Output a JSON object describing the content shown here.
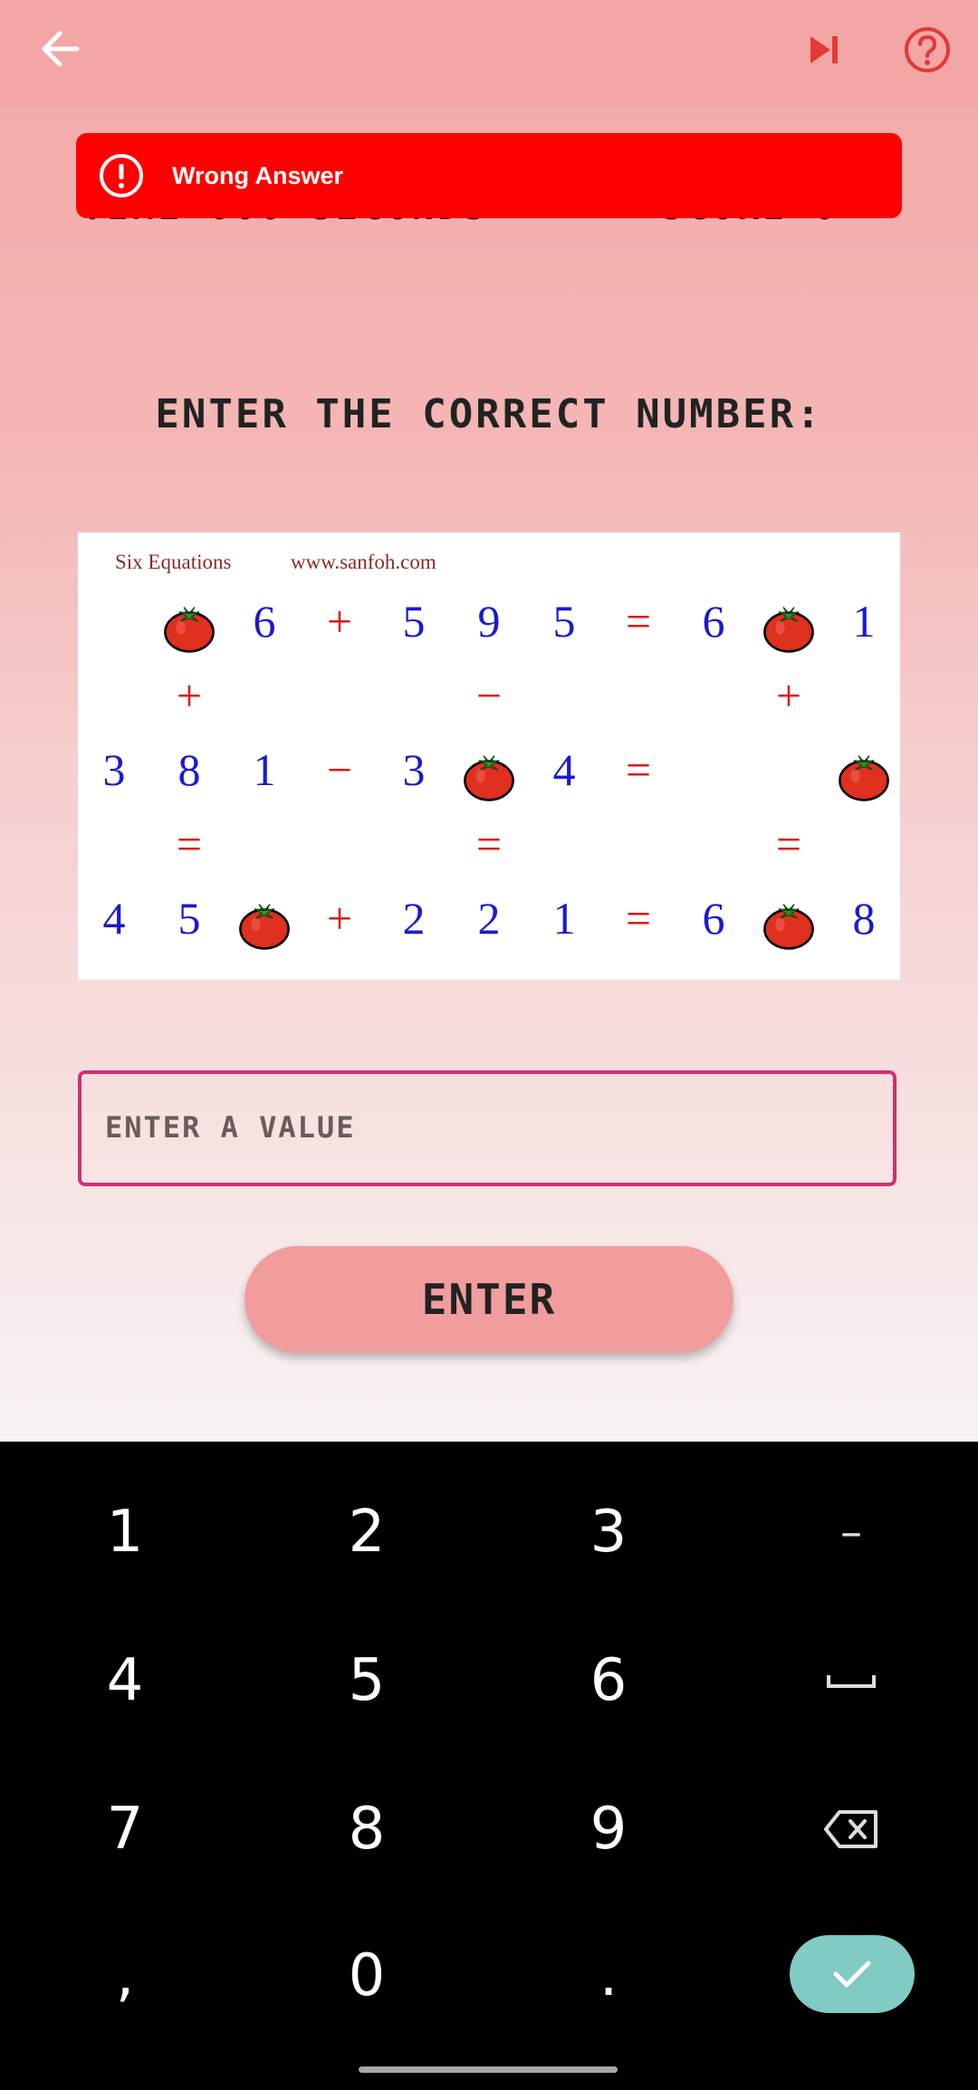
{
  "topbar": {
    "back_icon": "arrow-left-icon",
    "skip_icon": "skip-next-icon",
    "help_icon": "help-circle-icon",
    "accent": "#e53935"
  },
  "toast": {
    "message": "Wrong Answer",
    "icon": "alert-circle-icon",
    "color": "#ff0000"
  },
  "prompt": "ENTER THE CORRECT NUMBER:",
  "puzzle": {
    "title": "Six Equations",
    "site": "www.sanfoh.com",
    "rows": [
      [
        "",
        "🍅",
        "6",
        "+",
        "5",
        "9",
        "5",
        "=",
        "6",
        "🍅",
        "1"
      ],
      [
        "",
        "+",
        "",
        "",
        "",
        "−",
        "",
        "",
        "",
        "+",
        ""
      ],
      [
        "3",
        "8",
        "1",
        "−",
        "3",
        "🍅",
        "4",
        "=",
        "",
        "",
        "🍅"
      ],
      [
        "",
        "=",
        "",
        "",
        "",
        "=",
        "",
        "",
        "",
        "=",
        ""
      ],
      [
        "4",
        "5",
        "🍅",
        "+",
        "2",
        "2",
        "1",
        "=",
        "6",
        "🍅",
        "8"
      ]
    ]
  },
  "input": {
    "placeholder": "ENTER A VALUE",
    "value": ""
  },
  "enter_button": "ENTER",
  "keyboard": {
    "keys": [
      [
        "1",
        "2",
        "3",
        "–"
      ],
      [
        "4",
        "5",
        "6",
        "␣"
      ],
      [
        "7",
        "8",
        "9",
        "⌫"
      ],
      [
        ",",
        "0",
        ".",
        "✓"
      ]
    ],
    "done_color": "#80cbc4"
  }
}
